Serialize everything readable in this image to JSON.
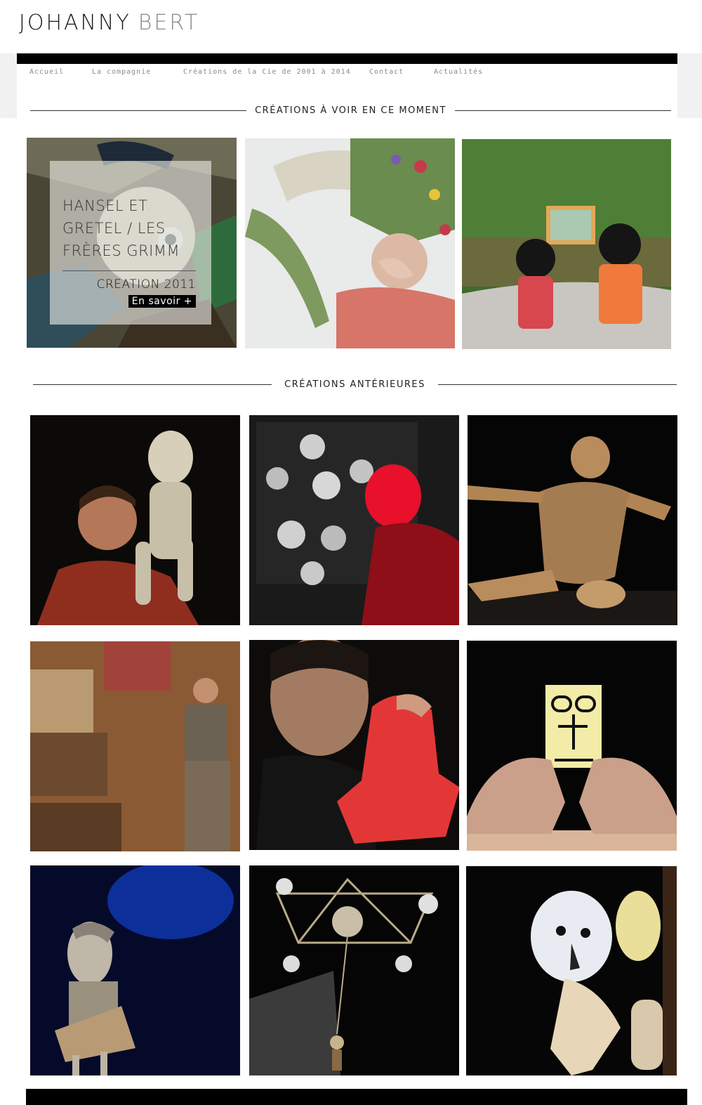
{
  "site": {
    "name_first": "JOHANNY",
    "name_last": "BERT"
  },
  "nav": [
    {
      "label": "Accueil"
    },
    {
      "label": "La compagnie"
    },
    {
      "label": "Créations de la Cie de 2001 à 2014"
    },
    {
      "label": "Contact"
    },
    {
      "label": "Actualités"
    }
  ],
  "current_section": {
    "title": "CRÉATIONS À VOIR EN CE MOMENT",
    "featured": {
      "title": "HANSEL ET GRETEL / LES FRÈRES GRIMM",
      "subtitle": "CREATION 2011",
      "cta": "En savoir +"
    }
  },
  "previous_section": {
    "title": "CRÉATIONS ANTÉRIEURES"
  },
  "colors": {
    "nav_text": "#8a8a8a",
    "bar": "#000000",
    "band": "#f1f1f1"
  },
  "icons": {
    "tiles_current": [
      "puppet-face-photo",
      "flower-crown-photo",
      "toy-figures-photo"
    ],
    "tiles_previous": [
      "man-with-puppet-photo",
      "red-mask-photo",
      "paper-puppet-photo",
      "junk-stage-photo",
      "red-foam-puppet-photo",
      "finger-puppet-photo",
      "opera-puppet-photo",
      "mobile-sculpture-photo",
      "white-puppet-photo"
    ]
  }
}
